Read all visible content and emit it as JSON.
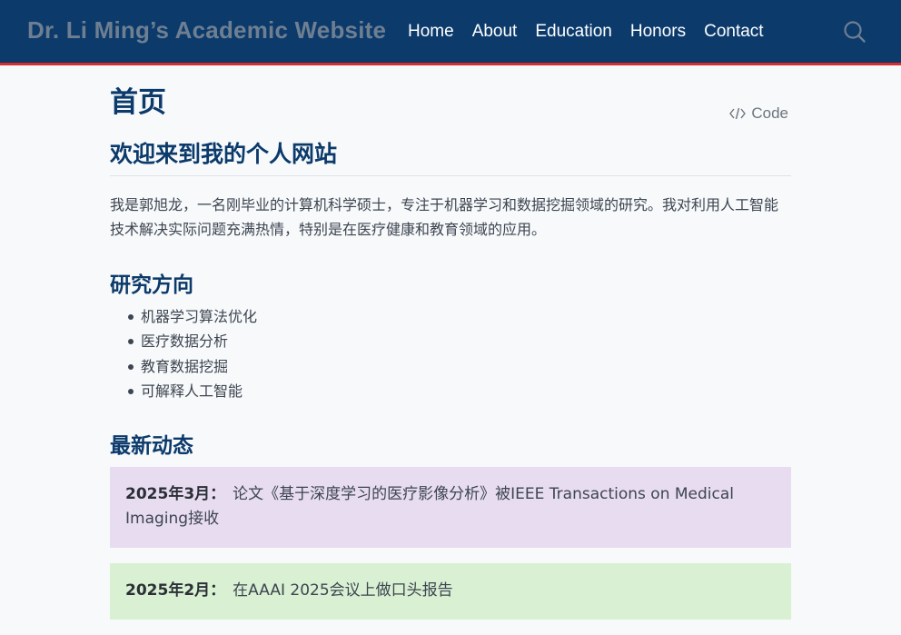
{
  "navbar": {
    "brand": "Dr. Li Ming’s Academic Website",
    "links": [
      "Home",
      "About",
      "Education",
      "Honors",
      "Contact"
    ],
    "search_icon": "search-icon",
    "colors": {
      "background": "#0b3a6b",
      "accent": "#d62d2d"
    }
  },
  "page": {
    "title": "首页",
    "code_label": "Code",
    "code_icon": "code-icon"
  },
  "welcome": {
    "heading": "欢迎来到我的个人网站",
    "text": "我是郭旭龙，一名刚毕业的计算机科学硕士，专注于机器学习和数据挖掘领域的研究。我对利用人工智能技术解决实际问题充满热情，特别是在医疗健康和教育领域的应用。"
  },
  "research": {
    "heading": "研究方向",
    "items": [
      "机器学习算法优化",
      "医疗数据分析",
      "教育数据挖掘",
      "可解释人工智能"
    ]
  },
  "news": {
    "heading": "最新动态",
    "items": [
      {
        "date": "2025年3月：",
        "text": "论文《基于深度学习的医疗影像分析》被IEEE Transactions on Medical Imaging接收",
        "color": "#e8dcf1"
      },
      {
        "date": "2025年2月：",
        "text": "在AAAI 2025会议上做口头报告",
        "color": "#d9f0d3"
      }
    ]
  }
}
